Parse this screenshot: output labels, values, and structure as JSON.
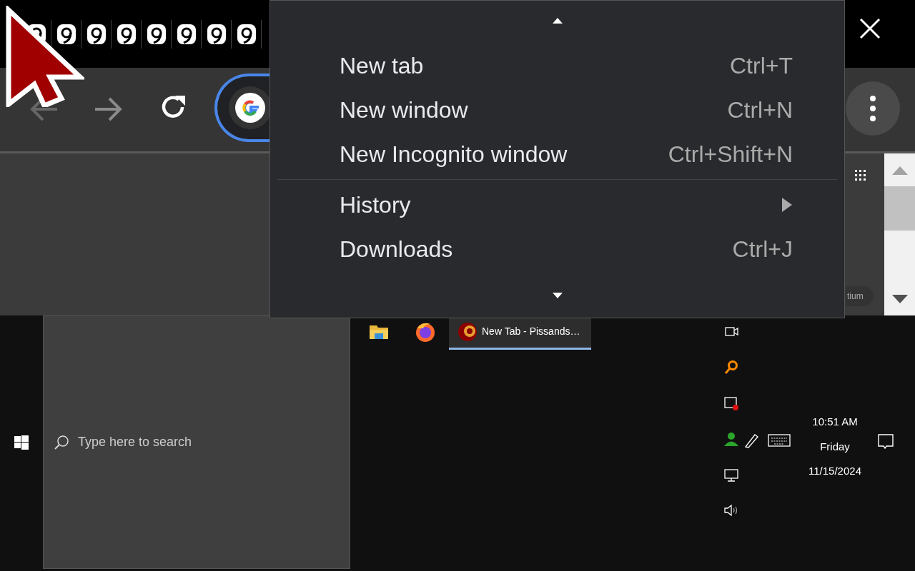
{
  "browser": {
    "omnibox": {
      "kind": "google"
    },
    "content": {
      "chip": "tium"
    }
  },
  "menu": {
    "sections": [
      [
        {
          "label": "New tab",
          "shortcut": "Ctrl+T",
          "kind": "item"
        },
        {
          "label": "New window",
          "shortcut": "Ctrl+N",
          "kind": "item"
        },
        {
          "label": "New Incognito window",
          "shortcut": "Ctrl+Shift+N",
          "kind": "item"
        }
      ],
      [
        {
          "label": "History",
          "kind": "submenu"
        },
        {
          "label": "Downloads",
          "shortcut": "Ctrl+J",
          "kind": "item"
        }
      ]
    ]
  },
  "taskbar": {
    "search": {
      "placeholder": "Type here to search"
    },
    "apps": [
      {
        "kind": "folder",
        "selected": false
      },
      {
        "kind": "firefox",
        "selected": false
      },
      {
        "kind": "chrome",
        "label": "New Tab - Pissands…",
        "selected": true
      }
    ],
    "clock": {
      "time": "10:51 AM",
      "day": "Friday",
      "date": "11/15/2024"
    }
  }
}
